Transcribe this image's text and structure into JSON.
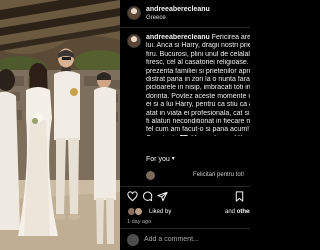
{
  "post": {
    "username": "andreeaberecleanu",
    "location": "Greece"
  },
  "caption": {
    "lines": [
      {
        "user": "andreeaberecleanu",
        "text": " Fericirea are chi"
      },
      {
        "user": "",
        "text": "lui. Anca si Harry, dragii nostri prieteni,"
      },
      {
        "user": "",
        "text": "firu. Bucurosi, plini unul de celalalt, ful"
      },
      {
        "user": "",
        "text": "firesc, cel al casatoriei religioase. Le."
      },
      {
        "user": "",
        "text": "prezenta familiei si prietenilor apropiat"
      },
      {
        "user": "",
        "text": "distrat pana in zori la o nunta fara greset"
      },
      {
        "user": "",
        "text": "picioarele in nisip, imbracati toti in alb,"
      },
      {
        "user": "",
        "text": "dorinta. Povtez aceste momente intime"
      },
      {
        "user": "",
        "text": "ei si a lui Harry, pentru ca stiu ca ati inv"
      },
      {
        "user": "",
        "text": "atat in viata ei profesionala, cat si perso"
      },
      {
        "user": "",
        "text": "fi alaturi neconditionat in fiecare mome"
      },
      {
        "user": "",
        "text": "fel cum am facut-o si pana acum! Cu dr"
      },
      {
        "user": "",
        "text": "Constantin🤍 @anca.lungu @harry_ara"
      }
    ]
  },
  "for_you": "For you",
  "reply": {
    "text": "Felicitari pentru tot!"
  },
  "actions": {
    "like_icon": "heart-icon",
    "comment_icon": "comment-icon",
    "share_icon": "share-icon",
    "save_icon": "bookmark-icon"
  },
  "likes": {
    "prefix": "Liked by",
    "suffix_and": "and",
    "suffix_others": "others"
  },
  "time_ago": "1 day ago",
  "comment_box": {
    "placeholder": "Add a comment..."
  },
  "colors": {
    "background": "#000000",
    "text": "#f5f5f5",
    "muted": "#a8a8a8",
    "divider": "#262626"
  }
}
